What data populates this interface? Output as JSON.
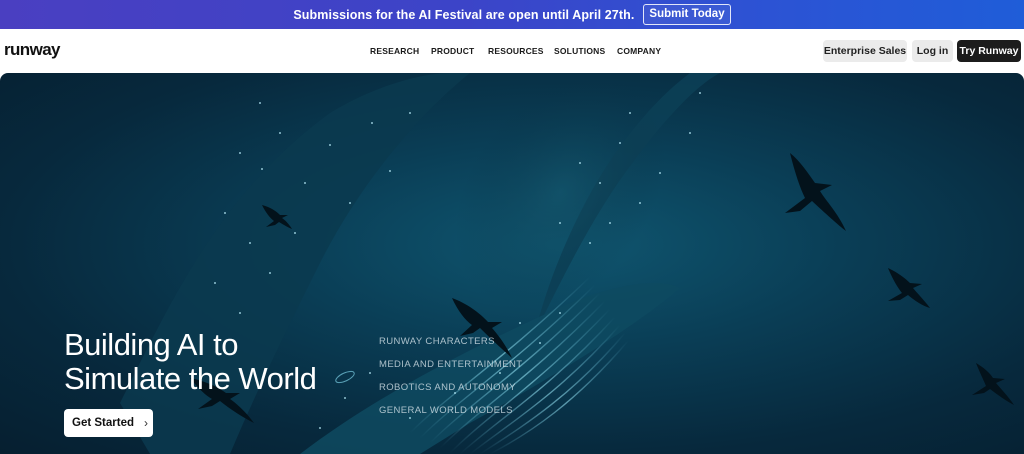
{
  "announcement": {
    "text": "Submissions for the AI Festival are open until April 27th.",
    "button_label": "Submit Today"
  },
  "brand": {
    "logo_text": "runway"
  },
  "nav": {
    "items": [
      {
        "label": "RESEARCH"
      },
      {
        "label": "PRODUCT"
      },
      {
        "label": "RESOURCES"
      },
      {
        "label": "SOLUTIONS"
      },
      {
        "label": "COMPANY"
      }
    ],
    "enterprise_label": "Enterprise Sales",
    "login_label": "Log in",
    "try_label": "Try Runway"
  },
  "hero": {
    "title_line1": "Building AI to",
    "title_line2": "Simulate the World",
    "cta_label": "Get Started",
    "cta_icon": "chevron-right-icon",
    "categories": [
      {
        "label": "RUNWAY CHARACTERS"
      },
      {
        "label": "MEDIA AND ENTERTAINMENT"
      },
      {
        "label": "ROBOTICS AND AUTONOMY"
      },
      {
        "label": "GENERAL WORLD MODELS"
      }
    ]
  },
  "colors": {
    "announcement_start": "#4a3fc1",
    "announcement_end": "#1f5dd8",
    "hero_deep": "#061f30",
    "hero_glow": "#0f5670",
    "try_button": "#1c1c1c"
  }
}
